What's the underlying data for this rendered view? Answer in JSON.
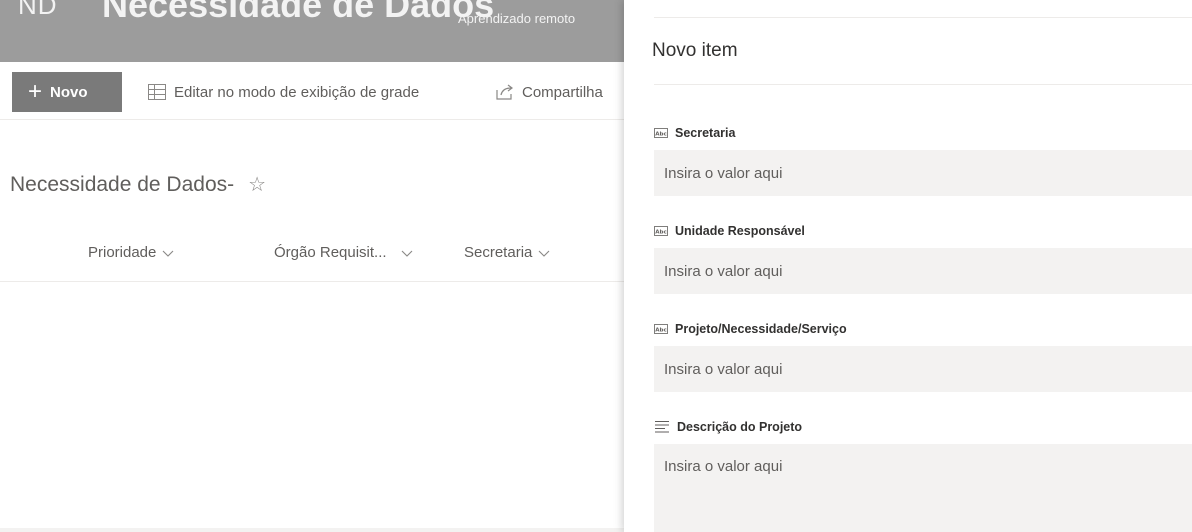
{
  "site": {
    "abbreviation": "ND",
    "title": "Necessidade de Dados",
    "description": "Aprendizado remoto"
  },
  "command_bar": {
    "new_label": "Novo",
    "grid_label": "Editar no modo de exibição de grade",
    "share_label": "Compartilha"
  },
  "list": {
    "title": "Necessidade de Dados-",
    "columns": [
      {
        "label": "Prioridade"
      },
      {
        "label": "Órgão Requisit..."
      },
      {
        "label": "Secretaria"
      }
    ]
  },
  "panel": {
    "title": "Novo item",
    "fields": [
      {
        "label": "Secretaria",
        "placeholder": "Insira o valor aqui",
        "icon": "text-field-icon"
      },
      {
        "label": "Unidade Responsável",
        "placeholder": "Insira o valor aqui",
        "icon": "text-field-icon"
      },
      {
        "label": "Projeto/Necessidade/Serviço",
        "placeholder": "Insira o valor aqui",
        "icon": "text-field-icon"
      },
      {
        "label": "Descrição do Projeto",
        "placeholder": "Insira o valor aqui",
        "icon": "multiline-text-icon"
      }
    ]
  },
  "colors": {
    "header_bg": "#9c9c9c",
    "new_button_bg": "#7a7a7a",
    "input_bg": "#f3f2f1"
  }
}
